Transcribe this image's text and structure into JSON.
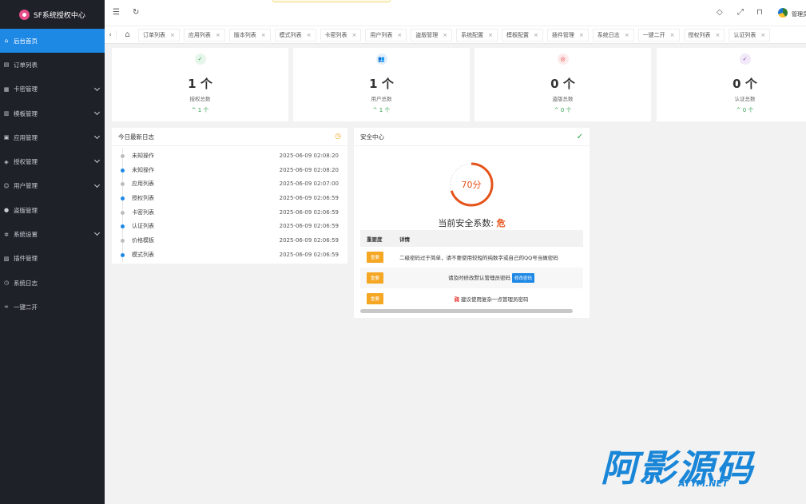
{
  "brand": {
    "title": "SF系统授权中心"
  },
  "sidebar": {
    "items": [
      {
        "label": "后台首页",
        "icon": "home-icon",
        "glyph": "⌂",
        "active": true,
        "expandable": false
      },
      {
        "label": "订单列表",
        "icon": "order-icon",
        "glyph": "▤",
        "active": false,
        "expandable": false
      },
      {
        "label": "卡密管理",
        "icon": "card-icon",
        "glyph": "▦",
        "active": false,
        "expandable": true
      },
      {
        "label": "模板管理",
        "icon": "template-icon",
        "glyph": "▥",
        "active": false,
        "expandable": true
      },
      {
        "label": "应用管理",
        "icon": "app-icon",
        "glyph": "▣",
        "active": false,
        "expandable": true
      },
      {
        "label": "授权管理",
        "icon": "shield-icon",
        "glyph": "◈",
        "active": false,
        "expandable": true
      },
      {
        "label": "用户管理",
        "icon": "user-icon",
        "glyph": "☺",
        "active": false,
        "expandable": true
      },
      {
        "label": "盗版管理",
        "icon": "piracy-icon",
        "glyph": "●",
        "active": false,
        "expandable": false
      },
      {
        "label": "系统设置",
        "icon": "gear-icon",
        "glyph": "✲",
        "active": false,
        "expandable": true
      },
      {
        "label": "插件管理",
        "icon": "plugin-icon",
        "glyph": "▧",
        "active": false,
        "expandable": false
      },
      {
        "label": "系统日志",
        "icon": "clock-icon",
        "glyph": "◷",
        "active": false,
        "expandable": false
      },
      {
        "label": "一键二开",
        "icon": "link-icon",
        "glyph": "∞",
        "active": false,
        "expandable": false
      }
    ]
  },
  "header": {
    "admin_name": "管理员"
  },
  "tabs": [
    "订单列表",
    "应用列表",
    "版本列表",
    "模式列表",
    "卡密列表",
    "用户列表",
    "盗版管理",
    "系统配置",
    "模板配置",
    "插件管理",
    "系统日志",
    "一键二开",
    "授权列表",
    "认证列表"
  ],
  "stats": [
    {
      "value": "1 个",
      "label": "授权总数",
      "trend": "^ 1 个",
      "icon": "shield-check-icon",
      "glyph": "✓",
      "color": "#2e9e4c",
      "bg": "#e6f6ea"
    },
    {
      "value": "1 个",
      "label": "用户总数",
      "trend": "^ 1 个",
      "icon": "users-icon",
      "glyph": "👥",
      "color": "#1e88e5",
      "bg": "#e3f0fc"
    },
    {
      "value": "0 个",
      "label": "盗版总数",
      "trend": "^ 0 个",
      "icon": "target-icon",
      "glyph": "◎",
      "color": "#e53935",
      "bg": "#fdeaea"
    },
    {
      "value": "0 个",
      "label": "认证总数",
      "trend": "^ 0 个",
      "icon": "verified-icon",
      "glyph": "✓",
      "color": "#8e44ad",
      "bg": "#f1e8f8"
    }
  ],
  "logs": {
    "title": "今日最新日志",
    "rows": [
      {
        "action": "未知操作",
        "time": "2025-06-09 02:08:20",
        "dot": "#bdbdbd"
      },
      {
        "action": "未知操作",
        "time": "2025-06-09 02:08:20",
        "dot": "#1e88e5"
      },
      {
        "action": "应用列表",
        "time": "2025-06-09 02:07:00",
        "dot": "#bdbdbd"
      },
      {
        "action": "授权列表",
        "time": "2025-06-09 02:06:59",
        "dot": "#1e88e5"
      },
      {
        "action": "卡密列表",
        "time": "2025-06-09 02:06:59",
        "dot": "#bdbdbd"
      },
      {
        "action": "认证列表",
        "time": "2025-06-09 02:06:59",
        "dot": "#1e88e5"
      },
      {
        "action": "价格模板",
        "time": "2025-06-09 02:06:59",
        "dot": "#bdbdbd"
      },
      {
        "action": "模式列表",
        "time": "2025-06-09 02:06:59",
        "dot": "#1e88e5"
      }
    ]
  },
  "security": {
    "title": "安全中心",
    "score_text": "70分",
    "score": 70,
    "level_label": "当前安全系数:",
    "level_value": "危",
    "columns": {
      "level": "重要度",
      "detail": "详情"
    },
    "rows": [
      {
        "level": "重要",
        "detail": "二级密码过于简单，请不要使用较短的纯数字或自己的QQ号当做密码",
        "action": ""
      },
      {
        "level": "重要",
        "detail": "请及时修改默认管理员密码",
        "action": "修改密码"
      },
      {
        "level": "重要",
        "detail": "建议使用复杂一点管理员密码",
        "action": "",
        "tag": "弱"
      }
    ]
  },
  "watermark": {
    "big": "阿影源码",
    "small": "AYYM.NET"
  }
}
